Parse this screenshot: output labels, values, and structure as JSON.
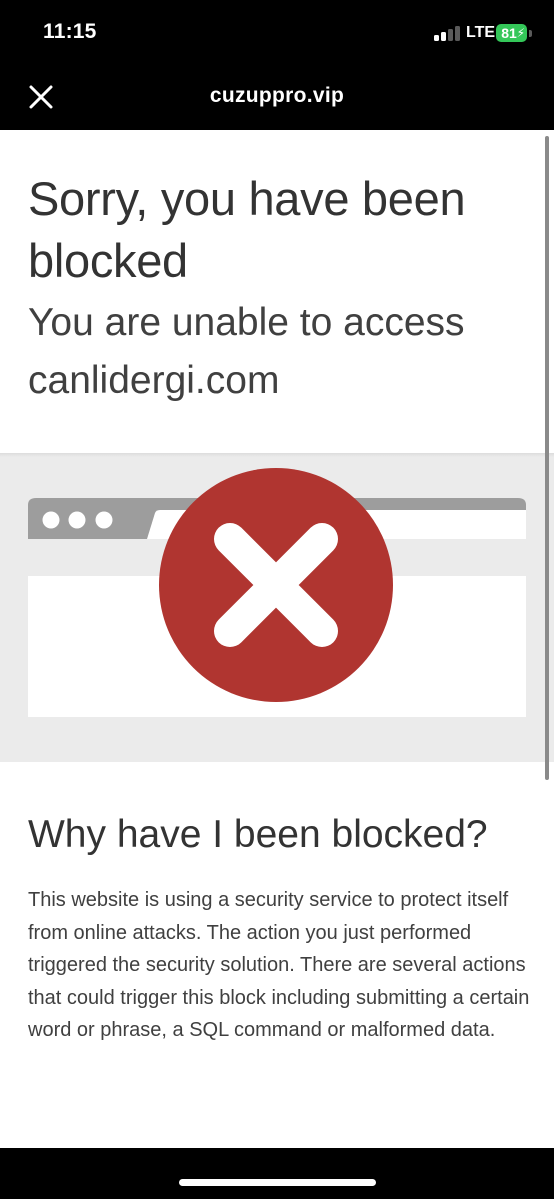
{
  "status_bar": {
    "time": "11:15",
    "network": "LTE",
    "battery_level": "81",
    "signal_bars_filled": 2,
    "signal_bars_total": 4
  },
  "nav": {
    "title": "cuzuppro.vip",
    "close_icon": "close-icon"
  },
  "page": {
    "heading": "Sorry, you have been blocked",
    "subheading": "You are unable to access canlidergi.com",
    "illustration_icon": "blocked-x-icon",
    "why_heading": "Why have I been blocked?",
    "why_body": "This website is using a security service to protect itself from online attacks. The action you just performed triggered the security solution. There are several actions that could trigger this block including submitting a certain word or phrase, a SQL command or malformed data."
  },
  "colors": {
    "accent_red": "#b03530",
    "browser_gray": "#9d9d9d",
    "band_gray": "#ebebeb",
    "battery_green": "#34c759",
    "text_dark": "#333333"
  }
}
